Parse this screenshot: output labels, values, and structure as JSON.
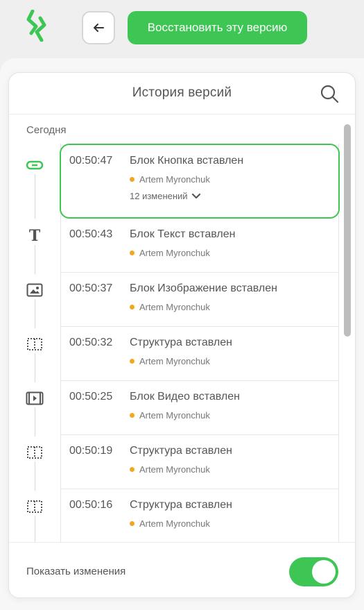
{
  "colors": {
    "accent": "#3ec654",
    "author_dot": "#f2a81d"
  },
  "toolbar": {
    "logo_icon": "bolt-logo-icon",
    "back_icon": "arrow-left-icon",
    "restore_label": "Восстановить эту версию"
  },
  "panel": {
    "title": "История версий",
    "search_icon": "search-icon",
    "section_label": "Сегодня",
    "entries": [
      {
        "time": "00:50:47",
        "desc": "Блок Кнопка вставлен",
        "author": "Artem Myronchuk",
        "icon": "button-block-icon",
        "changes": "12 изменений",
        "selected": true
      },
      {
        "time": "00:50:43",
        "desc": "Блок Текст вставлен",
        "author": "Artem Myronchuk",
        "icon": "text-block-icon"
      },
      {
        "time": "00:50:37",
        "desc": "Блок Изображение вставлен",
        "author": "Artem Myronchuk",
        "icon": "image-block-icon"
      },
      {
        "time": "00:50:32",
        "desc": "Структура вставлен",
        "author": "Artem Myronchuk",
        "icon": "structure-block-icon"
      },
      {
        "time": "00:50:25",
        "desc": "Блок Видео вставлен",
        "author": "Artem Myronchuk",
        "icon": "video-block-icon"
      },
      {
        "time": "00:50:19",
        "desc": "Структура вставлен",
        "author": "Artem Myronchuk",
        "icon": "structure-block-icon"
      },
      {
        "time": "00:50:16",
        "desc": "Структура вставлен",
        "author": "Artem Myronchuk",
        "icon": "structure-block-icon"
      }
    ]
  },
  "footer": {
    "label": "Показать изменения",
    "toggle_on": true
  }
}
